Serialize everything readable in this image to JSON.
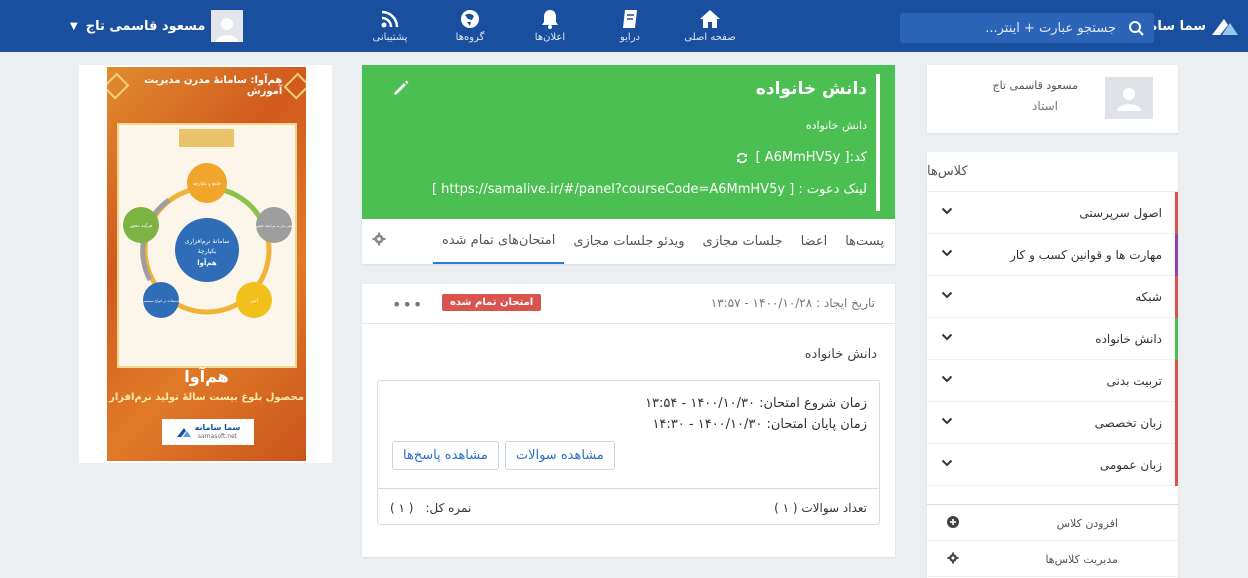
{
  "navbar": {
    "brand_text": "سما سامانه",
    "search_placeholder": "جستجو عبارت + اینتر...",
    "items": [
      {
        "label": "صفحه اصلی",
        "icon": "home-icon"
      },
      {
        "label": "درایو",
        "icon": "drive-icon"
      },
      {
        "label": "اعلان‌ها",
        "icon": "bell-icon"
      },
      {
        "label": "گروه‌ها",
        "icon": "groups-icon"
      },
      {
        "label": "پشتیبانی",
        "icon": "rss-icon"
      }
    ],
    "user_name": "مسعود قاسمی تاج",
    "colors": {
      "bar": "#1a4fa0",
      "search": "#2c64b8"
    }
  },
  "promo": {
    "top_text": "هم‌آوا: سامانهٔ مدرن مدیریت آموزش",
    "center_text": [
      "سامانهٔ نرم‌افزاری",
      "یکپارچهٔ",
      "هم‌آوا"
    ],
    "nodes": [
      "جامع و یکپارچه",
      "کاهش نیاز به مراجعهٔ حضوری",
      "امن",
      "قابل استفاده در انواع سیستم‌عامل",
      "فرآیند محور"
    ],
    "title": "هم‌آوا",
    "subtitle": "محصول بلوغ بیست سالهٔ تولید نرم‌افزار",
    "logo_text": "سما سامانه",
    "logo_sub": "samasoft.net"
  },
  "course": {
    "title": "دانش خانواده",
    "subtitle": "دانش خانواده",
    "code_line": "کد:[ A6MmHV5y ]",
    "invite_line": "لینک دعوت : [ https://samalive.ir/#/panel?courseCode=A6MmHV5y ]",
    "tabs": [
      "پست‌ها",
      "اعضا",
      "جلسات مجازی",
      "ویدئو جلسات مجازی",
      "امتحان‌های تمام شده"
    ],
    "active_tab": "امتحان‌های تمام شده",
    "color": "#4cbf53"
  },
  "exam": {
    "created_at": "تاریخ ایجاد : ۱۴۰۰/۱۰/۲۸ - ۱۳:۵۷",
    "status_badge": "امتحان تمام شده",
    "more": "•••",
    "name": "دانش خانواده",
    "start_time": "زمان شروع امتحان: ۱۴۰۰/۱۰/۳۰ - ۱۳:۵۴",
    "end_time": "زمان پایان امتحان: ۱۴۰۰/۱۰/۳۰ - ۱۴:۳۰",
    "view_questions": "مشاهده سوالات",
    "view_answers": "مشاهده پاسخ‌ها",
    "question_count": "تعداد سوالات ( ۱ )",
    "score_label": "نمره کل:",
    "score_value": "( ۱ )",
    "badge_color": "#d9534f"
  },
  "profile": {
    "name": "مسعود قاسمی تاج",
    "role": "استاد"
  },
  "classes": {
    "title": "کلاس‌ها",
    "items": [
      {
        "label": "اصول سرپرستی",
        "color": "#d9534f"
      },
      {
        "label": "مهارت ها و قوانین کسب و کار",
        "color": "#8e44ad"
      },
      {
        "label": "شبکه",
        "color": "#d9534f"
      },
      {
        "label": "دانش خانواده",
        "color": "#4cbf53"
      },
      {
        "label": "تربیت بدنی",
        "color": "#d9534f"
      },
      {
        "label": "زبان تخصصی",
        "color": "#d9534f"
      },
      {
        "label": "زبان عمومی",
        "color": "#d9534f"
      }
    ],
    "add_class": "افزودن کلاس",
    "manage_classes": "مدیریت کلاس‌ها"
  }
}
